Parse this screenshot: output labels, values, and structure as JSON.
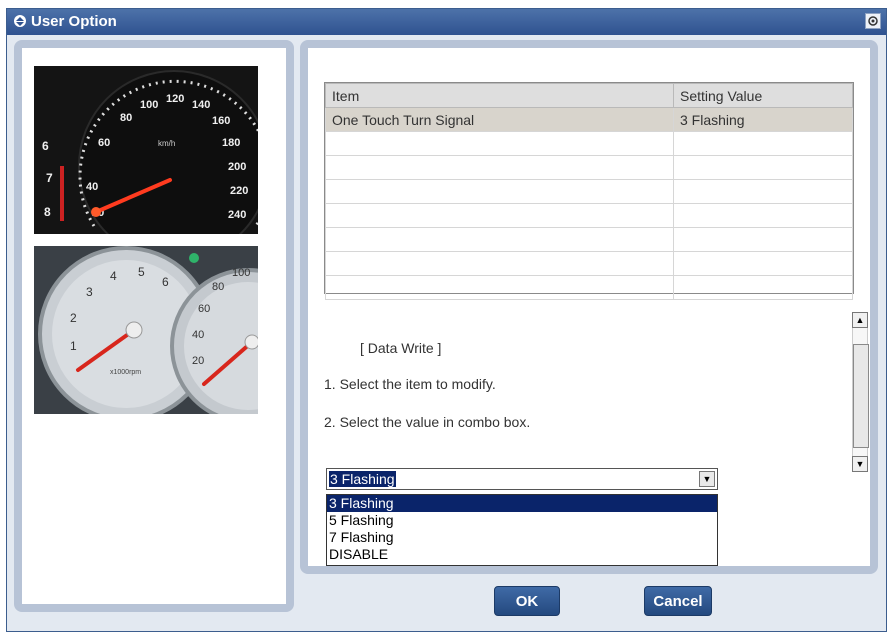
{
  "window": {
    "title": "User Option"
  },
  "table": {
    "headers": [
      "Item",
      "Setting Value"
    ],
    "rows": [
      {
        "item": "One Touch Turn Signal",
        "value": "3 Flashing"
      },
      {
        "item": "",
        "value": ""
      },
      {
        "item": "",
        "value": ""
      },
      {
        "item": "",
        "value": ""
      },
      {
        "item": "",
        "value": ""
      },
      {
        "item": "",
        "value": ""
      },
      {
        "item": "",
        "value": ""
      },
      {
        "item": "",
        "value": ""
      }
    ]
  },
  "instructions": {
    "heading": "[ Data Write ]",
    "step1": "1. Select the item to modify.",
    "step2": "2. Select the value in combo box."
  },
  "combo": {
    "selected": "3 Flashing",
    "options": [
      "3 Flashing",
      "5 Flashing",
      "7 Flashing",
      "DISABLE"
    ]
  },
  "buttons": {
    "ok": "OK",
    "cancel": "Cancel"
  },
  "gauges": {
    "speedo_ticks": [
      "20",
      "40",
      "60",
      "80",
      "100",
      "120",
      "140",
      "160",
      "180",
      "200",
      "220",
      "240"
    ],
    "speedo_unit": "km/h",
    "tacho_ticks": [
      "6",
      "7",
      "8"
    ],
    "tacho2_ticks": [
      "1",
      "2",
      "3",
      "4",
      "5",
      "6"
    ],
    "tacho2_unit": "x1000rpm",
    "speedo2_ticks": [
      "20",
      "40",
      "60",
      "80",
      "100"
    ]
  },
  "colors": {
    "title_bar": "#2f5290",
    "accent": "#0a246a",
    "panel_border": "#b7c3d6"
  }
}
